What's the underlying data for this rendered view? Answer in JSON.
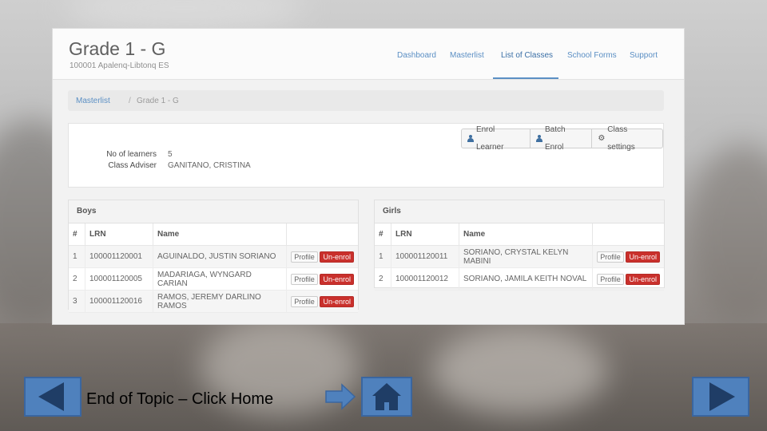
{
  "app": {
    "title": "Grade 1 - G",
    "school": "100001 Apalenq-Libtonq ES",
    "nav": [
      "Dashboard",
      "Masterlist",
      "List of Classes",
      "School Forms",
      "Support"
    ],
    "active_nav": "List of Classes"
  },
  "breadcrumb": {
    "link": "Masterlist",
    "separator": "/",
    "current": "Grade 1 - G"
  },
  "toolbar": {
    "enrol_learner": "Enrol Learner",
    "batch_enrol": "Batch Enrol",
    "class_settings": "Class settings"
  },
  "info": {
    "learners_label": "No of learners",
    "learners_value": "5",
    "adviser_label": "Class Adviser",
    "adviser_value": "GANITANO, CRISTINA"
  },
  "columns": {
    "num": "#",
    "lrn": "LRN",
    "name": "Name"
  },
  "buttons": {
    "profile": "Profile",
    "unenrol": "Un-enrol"
  },
  "boys": {
    "title": "Boys",
    "rows": [
      {
        "num": "1",
        "lrn": "100001120001",
        "name": "AGUINALDO, JUSTIN SORIANO"
      },
      {
        "num": "2",
        "lrn": "100001120005",
        "name": "MADARIAGA, WYNGARD CARIAN"
      },
      {
        "num": "3",
        "lrn": "100001120016",
        "name": "RAMOS, JEREMY DARLINO RAMOS"
      }
    ]
  },
  "girls": {
    "title": "Girls",
    "rows": [
      {
        "num": "1",
        "lrn": "100001120011",
        "name": "SORIANO, CRYSTAL KELYN MABINI"
      },
      {
        "num": "2",
        "lrn": "100001120012",
        "name": "SORIANO, JAMILA KEITH NOVAL"
      }
    ]
  },
  "slide": {
    "footer_text": "End of Topic – Click Home",
    "button_color": "#4f81bd",
    "icons": [
      "back-arrow-icon",
      "right-arrow-icon",
      "home-icon",
      "forward-arrow-icon"
    ]
  }
}
